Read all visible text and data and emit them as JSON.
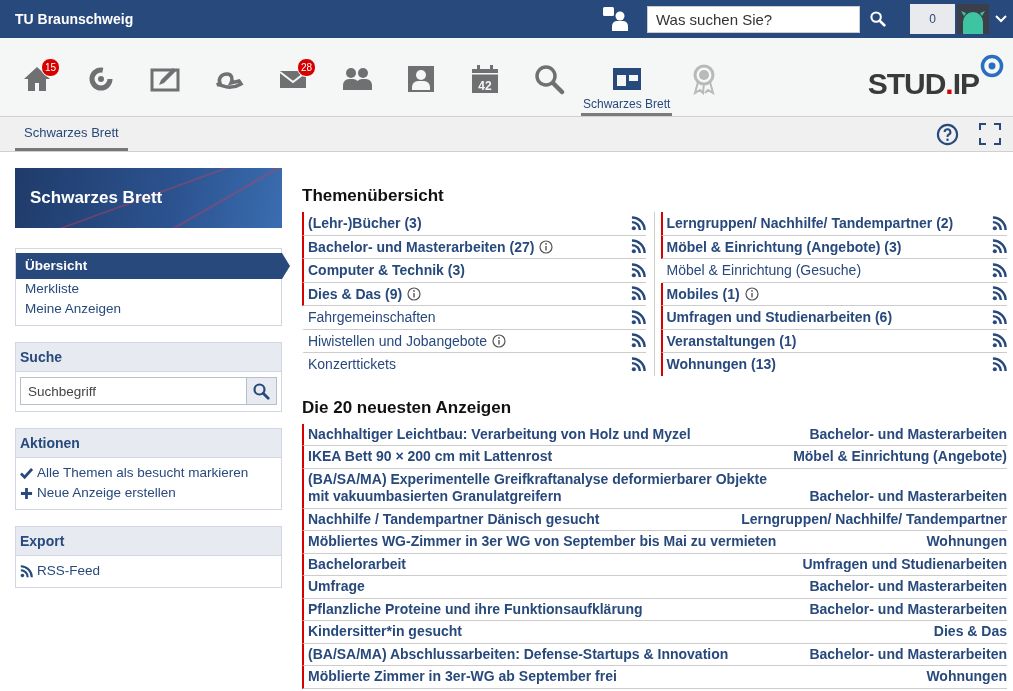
{
  "header": {
    "title": "TU Braunschweig",
    "search": {
      "placeholder": "Was suchen Sie?"
    },
    "notification_count": "0"
  },
  "nav": [
    {
      "kind": "home",
      "badge": "15",
      "selected": false
    },
    {
      "kind": "ring",
      "selected": false
    },
    {
      "kind": "edit",
      "selected": false
    },
    {
      "kind": "hand",
      "selected": false
    },
    {
      "kind": "mail",
      "badge": "28",
      "selected": false
    },
    {
      "kind": "people",
      "selected": false
    },
    {
      "kind": "profile",
      "selected": false
    },
    {
      "kind": "calendar",
      "text": "42",
      "selected": false
    },
    {
      "kind": "search",
      "selected": false
    },
    {
      "kind": "board",
      "label": "Schwarzes Brett",
      "selected": true
    },
    {
      "kind": "award",
      "selected": false
    }
  ],
  "logo": {
    "parts": [
      "STUD",
      ".",
      "IP"
    ]
  },
  "tabs": [
    {
      "label": "Schwarzes Brett",
      "selected": true
    }
  ],
  "sidebar": {
    "title": "Schwarzes Brett",
    "views": [
      {
        "label": "Übersicht",
        "selected": true
      },
      {
        "label": "Merkliste",
        "selected": false
      },
      {
        "label": "Meine Anzeigen",
        "selected": false
      }
    ],
    "search": {
      "title": "Suche",
      "placeholder": "Suchbegriff"
    },
    "actions": {
      "title": "Aktionen",
      "items": [
        {
          "kind": "check",
          "label": "Alle Themen als besucht markieren"
        },
        {
          "kind": "plus",
          "label": "Neue Anzeige erstellen"
        }
      ]
    },
    "export": {
      "title": "Export",
      "items": [
        {
          "kind": "rss",
          "label": "RSS-Feed"
        }
      ]
    }
  },
  "topics": {
    "title": "Themenübersicht",
    "items": [
      {
        "label": "(Lehr-)Bücher (3)",
        "unread": true,
        "info": false
      },
      {
        "label": "Bachelor- und Masterarbeiten (27)",
        "unread": true,
        "info": true
      },
      {
        "label": "Computer & Technik (3)",
        "unread": true,
        "info": false
      },
      {
        "label": "Dies & Das (9)",
        "unread": true,
        "info": true
      },
      {
        "label": "Fahrgemeinschaften",
        "unread": false,
        "info": false
      },
      {
        "label": "Hiwistellen und Jobangebote",
        "unread": false,
        "info": true
      },
      {
        "label": "Konzerttickets",
        "unread": false,
        "info": false
      },
      {
        "label": "Lerngruppen/ Nachhilfe/ Tandempartner (2)",
        "unread": true,
        "info": false
      },
      {
        "label": "Möbel & Einrichtung (Angebote) (3)",
        "unread": true,
        "info": false
      },
      {
        "label": "Möbel & Einrichtung (Gesuche)",
        "unread": false,
        "info": false
      },
      {
        "label": "Mobiles (1)",
        "unread": true,
        "info": true
      },
      {
        "label": "Umfragen und Studienarbeiten (6)",
        "unread": true,
        "info": false
      },
      {
        "label": "Veranstaltungen (1)",
        "unread": true,
        "info": false
      },
      {
        "label": "Wohnungen (13)",
        "unread": true,
        "info": false
      }
    ]
  },
  "ads": {
    "title": "Die 20 neuesten Anzeigen",
    "rows": [
      {
        "title": "Nachhaltiger Leichtbau: Verarbeitung von Holz und Myzel",
        "topic": "Bachelor- und Masterarbeiten"
      },
      {
        "title": "IKEA Bett 90 × 200 cm mit Lattenrost",
        "topic": "Möbel & Einrichtung (Angebote)"
      },
      {
        "title": "(BA/SA/MA) Experimentelle Greifkraftanalyse deformierbarer Objekte mit vakuumbasierten Granulatgreifern",
        "topic": "Bachelor- und Masterarbeiten"
      },
      {
        "title": "Nachhilfe / Tandempartner Dänisch gesucht",
        "topic": "Lerngruppen/ Nachhilfe/ Tandempartner"
      },
      {
        "title": "Möbliertes WG-Zimmer in 3er WG von September bis Mai zu vermieten",
        "topic": "Wohnungen"
      },
      {
        "title": "Bachelorarbeit",
        "topic": "Umfragen und Studienarbeiten"
      },
      {
        "title": "Umfrage",
        "topic": "Bachelor- und Masterarbeiten"
      },
      {
        "title": "Pflanzliche Proteine und ihre Funktionsaufklärung",
        "topic": "Bachelor- und Masterarbeiten"
      },
      {
        "title": "Kindersitter*in gesucht",
        "topic": "Dies & Das"
      },
      {
        "title": "(BA/SA/MA) Abschlussarbeiten: Defense-Startups & Innovation",
        "topic": "Bachelor- und Masterarbeiten"
      },
      {
        "title": "Möblierte Zimmer in 3er-WG ab September frei",
        "topic": "Wohnungen"
      }
    ]
  }
}
